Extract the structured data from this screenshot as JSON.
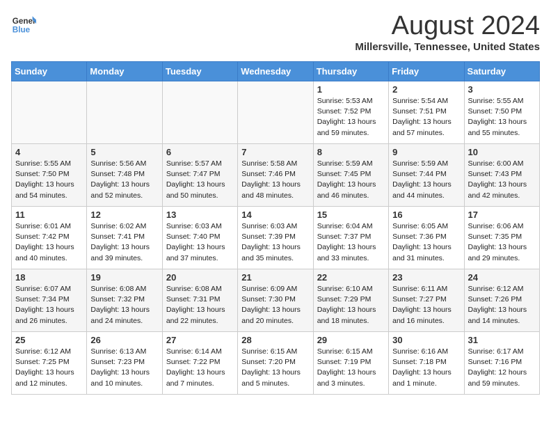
{
  "header": {
    "logo_line1": "General",
    "logo_line2": "Blue",
    "title": "August 2024",
    "subtitle": "Millersville, Tennessee, United States"
  },
  "days_of_week": [
    "Sunday",
    "Monday",
    "Tuesday",
    "Wednesday",
    "Thursday",
    "Friday",
    "Saturday"
  ],
  "weeks": [
    [
      {
        "day": "",
        "info": ""
      },
      {
        "day": "",
        "info": ""
      },
      {
        "day": "",
        "info": ""
      },
      {
        "day": "",
        "info": ""
      },
      {
        "day": "1",
        "info": "Sunrise: 5:53 AM\nSunset: 7:52 PM\nDaylight: 13 hours\nand 59 minutes."
      },
      {
        "day": "2",
        "info": "Sunrise: 5:54 AM\nSunset: 7:51 PM\nDaylight: 13 hours\nand 57 minutes."
      },
      {
        "day": "3",
        "info": "Sunrise: 5:55 AM\nSunset: 7:50 PM\nDaylight: 13 hours\nand 55 minutes."
      }
    ],
    [
      {
        "day": "4",
        "info": "Sunrise: 5:55 AM\nSunset: 7:50 PM\nDaylight: 13 hours\nand 54 minutes."
      },
      {
        "day": "5",
        "info": "Sunrise: 5:56 AM\nSunset: 7:48 PM\nDaylight: 13 hours\nand 52 minutes."
      },
      {
        "day": "6",
        "info": "Sunrise: 5:57 AM\nSunset: 7:47 PM\nDaylight: 13 hours\nand 50 minutes."
      },
      {
        "day": "7",
        "info": "Sunrise: 5:58 AM\nSunset: 7:46 PM\nDaylight: 13 hours\nand 48 minutes."
      },
      {
        "day": "8",
        "info": "Sunrise: 5:59 AM\nSunset: 7:45 PM\nDaylight: 13 hours\nand 46 minutes."
      },
      {
        "day": "9",
        "info": "Sunrise: 5:59 AM\nSunset: 7:44 PM\nDaylight: 13 hours\nand 44 minutes."
      },
      {
        "day": "10",
        "info": "Sunrise: 6:00 AM\nSunset: 7:43 PM\nDaylight: 13 hours\nand 42 minutes."
      }
    ],
    [
      {
        "day": "11",
        "info": "Sunrise: 6:01 AM\nSunset: 7:42 PM\nDaylight: 13 hours\nand 40 minutes."
      },
      {
        "day": "12",
        "info": "Sunrise: 6:02 AM\nSunset: 7:41 PM\nDaylight: 13 hours\nand 39 minutes."
      },
      {
        "day": "13",
        "info": "Sunrise: 6:03 AM\nSunset: 7:40 PM\nDaylight: 13 hours\nand 37 minutes."
      },
      {
        "day": "14",
        "info": "Sunrise: 6:03 AM\nSunset: 7:39 PM\nDaylight: 13 hours\nand 35 minutes."
      },
      {
        "day": "15",
        "info": "Sunrise: 6:04 AM\nSunset: 7:37 PM\nDaylight: 13 hours\nand 33 minutes."
      },
      {
        "day": "16",
        "info": "Sunrise: 6:05 AM\nSunset: 7:36 PM\nDaylight: 13 hours\nand 31 minutes."
      },
      {
        "day": "17",
        "info": "Sunrise: 6:06 AM\nSunset: 7:35 PM\nDaylight: 13 hours\nand 29 minutes."
      }
    ],
    [
      {
        "day": "18",
        "info": "Sunrise: 6:07 AM\nSunset: 7:34 PM\nDaylight: 13 hours\nand 26 minutes."
      },
      {
        "day": "19",
        "info": "Sunrise: 6:08 AM\nSunset: 7:32 PM\nDaylight: 13 hours\nand 24 minutes."
      },
      {
        "day": "20",
        "info": "Sunrise: 6:08 AM\nSunset: 7:31 PM\nDaylight: 13 hours\nand 22 minutes."
      },
      {
        "day": "21",
        "info": "Sunrise: 6:09 AM\nSunset: 7:30 PM\nDaylight: 13 hours\nand 20 minutes."
      },
      {
        "day": "22",
        "info": "Sunrise: 6:10 AM\nSunset: 7:29 PM\nDaylight: 13 hours\nand 18 minutes."
      },
      {
        "day": "23",
        "info": "Sunrise: 6:11 AM\nSunset: 7:27 PM\nDaylight: 13 hours\nand 16 minutes."
      },
      {
        "day": "24",
        "info": "Sunrise: 6:12 AM\nSunset: 7:26 PM\nDaylight: 13 hours\nand 14 minutes."
      }
    ],
    [
      {
        "day": "25",
        "info": "Sunrise: 6:12 AM\nSunset: 7:25 PM\nDaylight: 13 hours\nand 12 minutes."
      },
      {
        "day": "26",
        "info": "Sunrise: 6:13 AM\nSunset: 7:23 PM\nDaylight: 13 hours\nand 10 minutes."
      },
      {
        "day": "27",
        "info": "Sunrise: 6:14 AM\nSunset: 7:22 PM\nDaylight: 13 hours\nand 7 minutes."
      },
      {
        "day": "28",
        "info": "Sunrise: 6:15 AM\nSunset: 7:20 PM\nDaylight: 13 hours\nand 5 minutes."
      },
      {
        "day": "29",
        "info": "Sunrise: 6:15 AM\nSunset: 7:19 PM\nDaylight: 13 hours\nand 3 minutes."
      },
      {
        "day": "30",
        "info": "Sunrise: 6:16 AM\nSunset: 7:18 PM\nDaylight: 13 hours\nand 1 minute."
      },
      {
        "day": "31",
        "info": "Sunrise: 6:17 AM\nSunset: 7:16 PM\nDaylight: 12 hours\nand 59 minutes."
      }
    ]
  ]
}
